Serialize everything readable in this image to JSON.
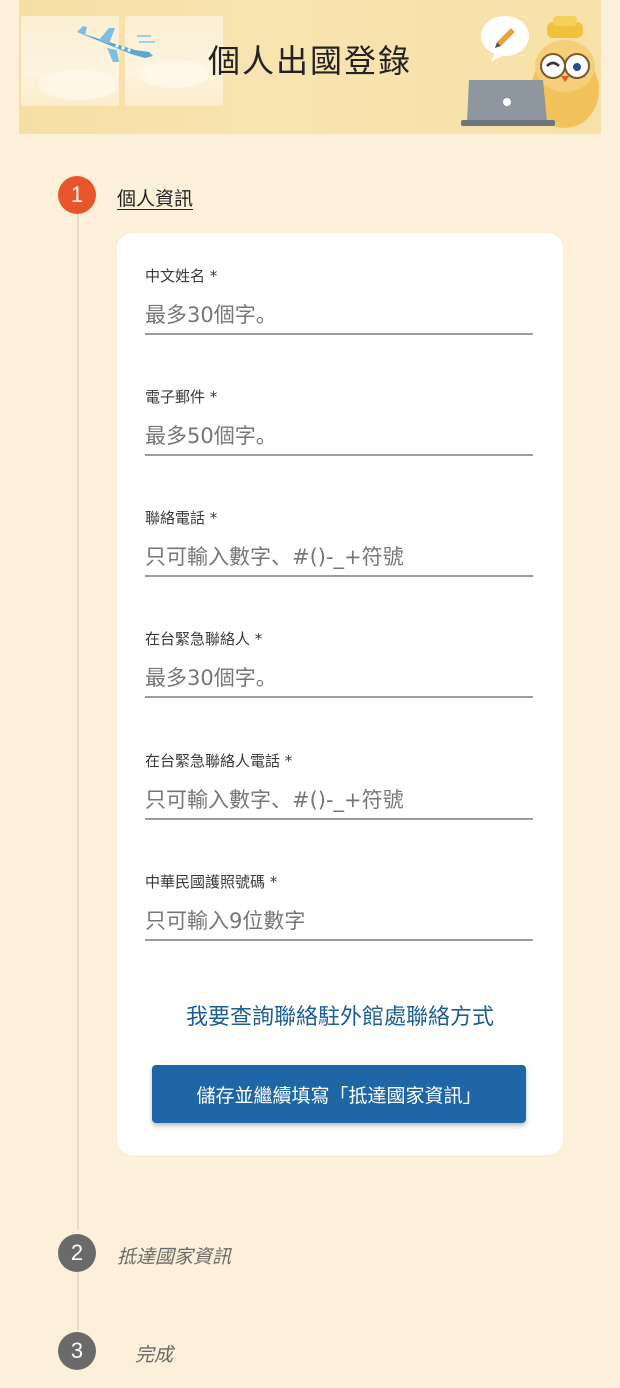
{
  "header": {
    "title": "個人出國登錄"
  },
  "steps": [
    {
      "number": "1",
      "label": "個人資訊",
      "state": "active"
    },
    {
      "number": "2",
      "label": "抵達國家資訊",
      "state": "inactive"
    },
    {
      "number": "3",
      "label": "完成",
      "state": "inactive"
    }
  ],
  "form": {
    "fields": [
      {
        "label": "中文姓名 *",
        "placeholder": "最多30個字。"
      },
      {
        "label": "電子郵件 *",
        "placeholder": "最多50個字。"
      },
      {
        "label": "聯絡電話 *",
        "placeholder": "只可輸入數字、#()-_+符號"
      },
      {
        "label": "在台緊急聯絡人 *",
        "placeholder": "最多30個字。"
      },
      {
        "label": "在台緊急聯絡人電話 *",
        "placeholder": "只可輸入數字、#()-_+符號"
      },
      {
        "label": "中華民國護照號碼 *",
        "placeholder": "只可輸入9位數字"
      }
    ],
    "query_link": "我要查詢聯絡駐外館處聯絡方式",
    "submit_label": "儲存並繼續填寫「抵達國家資訊」"
  },
  "colors": {
    "background": "#fcf0db",
    "active_step": "#e8552b",
    "inactive_step": "#6a6a6a",
    "link": "#1d5f94",
    "button": "#1e66a6"
  },
  "icons": {
    "banner_left": "airplane-icon",
    "banner_right": "owl-mascot-laptop-icon"
  }
}
